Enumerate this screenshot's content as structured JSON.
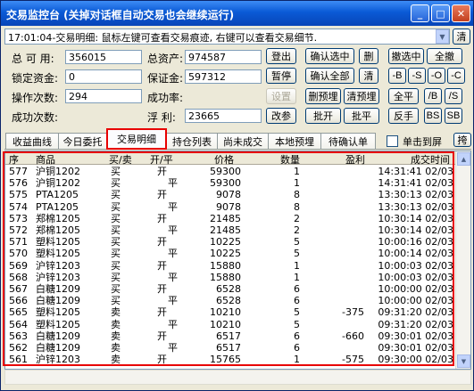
{
  "window": {
    "title": "交易监控台 (关掉对话框自动交易也会继续运行)",
    "min_glyph": "_",
    "max_glyph": "□",
    "close_glyph": "✕"
  },
  "message": {
    "text": "17:01:04-交易明细: 鼠标左键可查看交易痕迹, 右键可以查看交易细节.",
    "clear_label": "清"
  },
  "account": {
    "total_available_label": "总 可 用:",
    "total_available": "356015",
    "total_assets_label": "总资产:",
    "total_assets": "974587",
    "locked_funds_label": "锁定资金:",
    "locked_funds": "0",
    "margin_label": "保证金:",
    "margin": "597312",
    "op_count_label": "操作次数:",
    "op_count": "294",
    "success_rate_label": "成功率:",
    "success_rate": "",
    "success_count_label": "成功次数:",
    "success_count": "",
    "floating_pl_label": "浮  利:",
    "floating_pl": "23665"
  },
  "buttons": {
    "login": "登出",
    "pause": "暂停",
    "settings": "设置",
    "revise": "改参",
    "confirm_selected": "确认选中",
    "confirm_all": "确认全部",
    "lock_detail": "删预埋",
    "clear_detail": "清预埋",
    "batch_open": "批开",
    "batch_close": "批平",
    "delete": "删",
    "clear": "清",
    "cancel_selected": "撤选中",
    "cancel_all": "全撤",
    "minus_b": "-B",
    "minus_s": "-S",
    "minus_o": "-O",
    "minus_c": "-C",
    "close_all": "全平",
    "slash_b": "/B",
    "slash_s": "/S",
    "reverse": "反手",
    "bs": "BS",
    "sb": "SB"
  },
  "tabs": [
    "收益曲线",
    "今日委托",
    "交易明细",
    "持仓列表",
    "尚未成交",
    "本地预埋",
    "待确认单"
  ],
  "active_tab": "交易明细",
  "single_click_flat_label": "单击到屏",
  "expand_label": "挎",
  "grid": {
    "columns": [
      "序",
      "商品",
      "买/卖",
      "开/平",
      "价格",
      "数量",
      "盈利",
      "成交时间"
    ],
    "rows": [
      {
        "seq": "577",
        "item": "沪铜1202",
        "side": "买",
        "oc": "开",
        "price": "59300",
        "qty": "1",
        "profit": "",
        "time": "14:31:41 02/03"
      },
      {
        "seq": "576",
        "item": "沪铜1202",
        "side": "买",
        "oc": "平",
        "price": "59300",
        "qty": "1",
        "profit": "",
        "time": "14:31:41 02/03"
      },
      {
        "seq": "575",
        "item": "PTA1205",
        "side": "买",
        "oc": "开",
        "price": "9078",
        "qty": "8",
        "profit": "",
        "time": "13:30:13 02/03"
      },
      {
        "seq": "574",
        "item": "PTA1205",
        "side": "买",
        "oc": "平",
        "price": "9078",
        "qty": "8",
        "profit": "",
        "time": "13:30:13 02/03"
      },
      {
        "seq": "573",
        "item": "郑棉1205",
        "side": "买",
        "oc": "开",
        "price": "21485",
        "qty": "2",
        "profit": "",
        "time": "10:30:14 02/03"
      },
      {
        "seq": "572",
        "item": "郑棉1205",
        "side": "买",
        "oc": "平",
        "price": "21485",
        "qty": "2",
        "profit": "",
        "time": "10:30:14 02/03"
      },
      {
        "seq": "571",
        "item": "塑料1205",
        "side": "买",
        "oc": "开",
        "price": "10225",
        "qty": "5",
        "profit": "",
        "time": "10:00:16 02/03"
      },
      {
        "seq": "570",
        "item": "塑料1205",
        "side": "买",
        "oc": "平",
        "price": "10225",
        "qty": "5",
        "profit": "",
        "time": "10:00:14 02/03"
      },
      {
        "seq": "569",
        "item": "沪锌1203",
        "side": "买",
        "oc": "开",
        "price": "15880",
        "qty": "1",
        "profit": "",
        "time": "10:00:03 02/03"
      },
      {
        "seq": "568",
        "item": "沪锌1203",
        "side": "买",
        "oc": "平",
        "price": "15880",
        "qty": "1",
        "profit": "",
        "time": "10:00:03 02/03"
      },
      {
        "seq": "567",
        "item": "白糖1209",
        "side": "买",
        "oc": "开",
        "price": "6528",
        "qty": "6",
        "profit": "",
        "time": "10:00:00 02/03"
      },
      {
        "seq": "566",
        "item": "白糖1209",
        "side": "买",
        "oc": "平",
        "price": "6528",
        "qty": "6",
        "profit": "",
        "time": "10:00:00 02/03"
      },
      {
        "seq": "565",
        "item": "塑料1205",
        "side": "卖",
        "oc": "开",
        "price": "10210",
        "qty": "5",
        "profit": "-375",
        "time": "09:31:20 02/03"
      },
      {
        "seq": "564",
        "item": "塑料1205",
        "side": "卖",
        "oc": "平",
        "price": "10210",
        "qty": "5",
        "profit": "",
        "time": "09:31:20 02/03"
      },
      {
        "seq": "563",
        "item": "白糖1209",
        "side": "卖",
        "oc": "开",
        "price": "6517",
        "qty": "6",
        "profit": "-660",
        "time": "09:30:01 02/03"
      },
      {
        "seq": "562",
        "item": "白糖1209",
        "side": "卖",
        "oc": "平",
        "price": "6517",
        "qty": "6",
        "profit": "",
        "time": "09:30:01 02/03"
      },
      {
        "seq": "561",
        "item": "沪锌1203",
        "side": "卖",
        "oc": "开",
        "price": "15765",
        "qty": "1",
        "profit": "-575",
        "time": "09:30:00 02/03"
      }
    ]
  },
  "colors": {
    "title_bar": "#0a5ad6",
    "highlight": "#e80000",
    "window_bg": "#ece9d8"
  }
}
